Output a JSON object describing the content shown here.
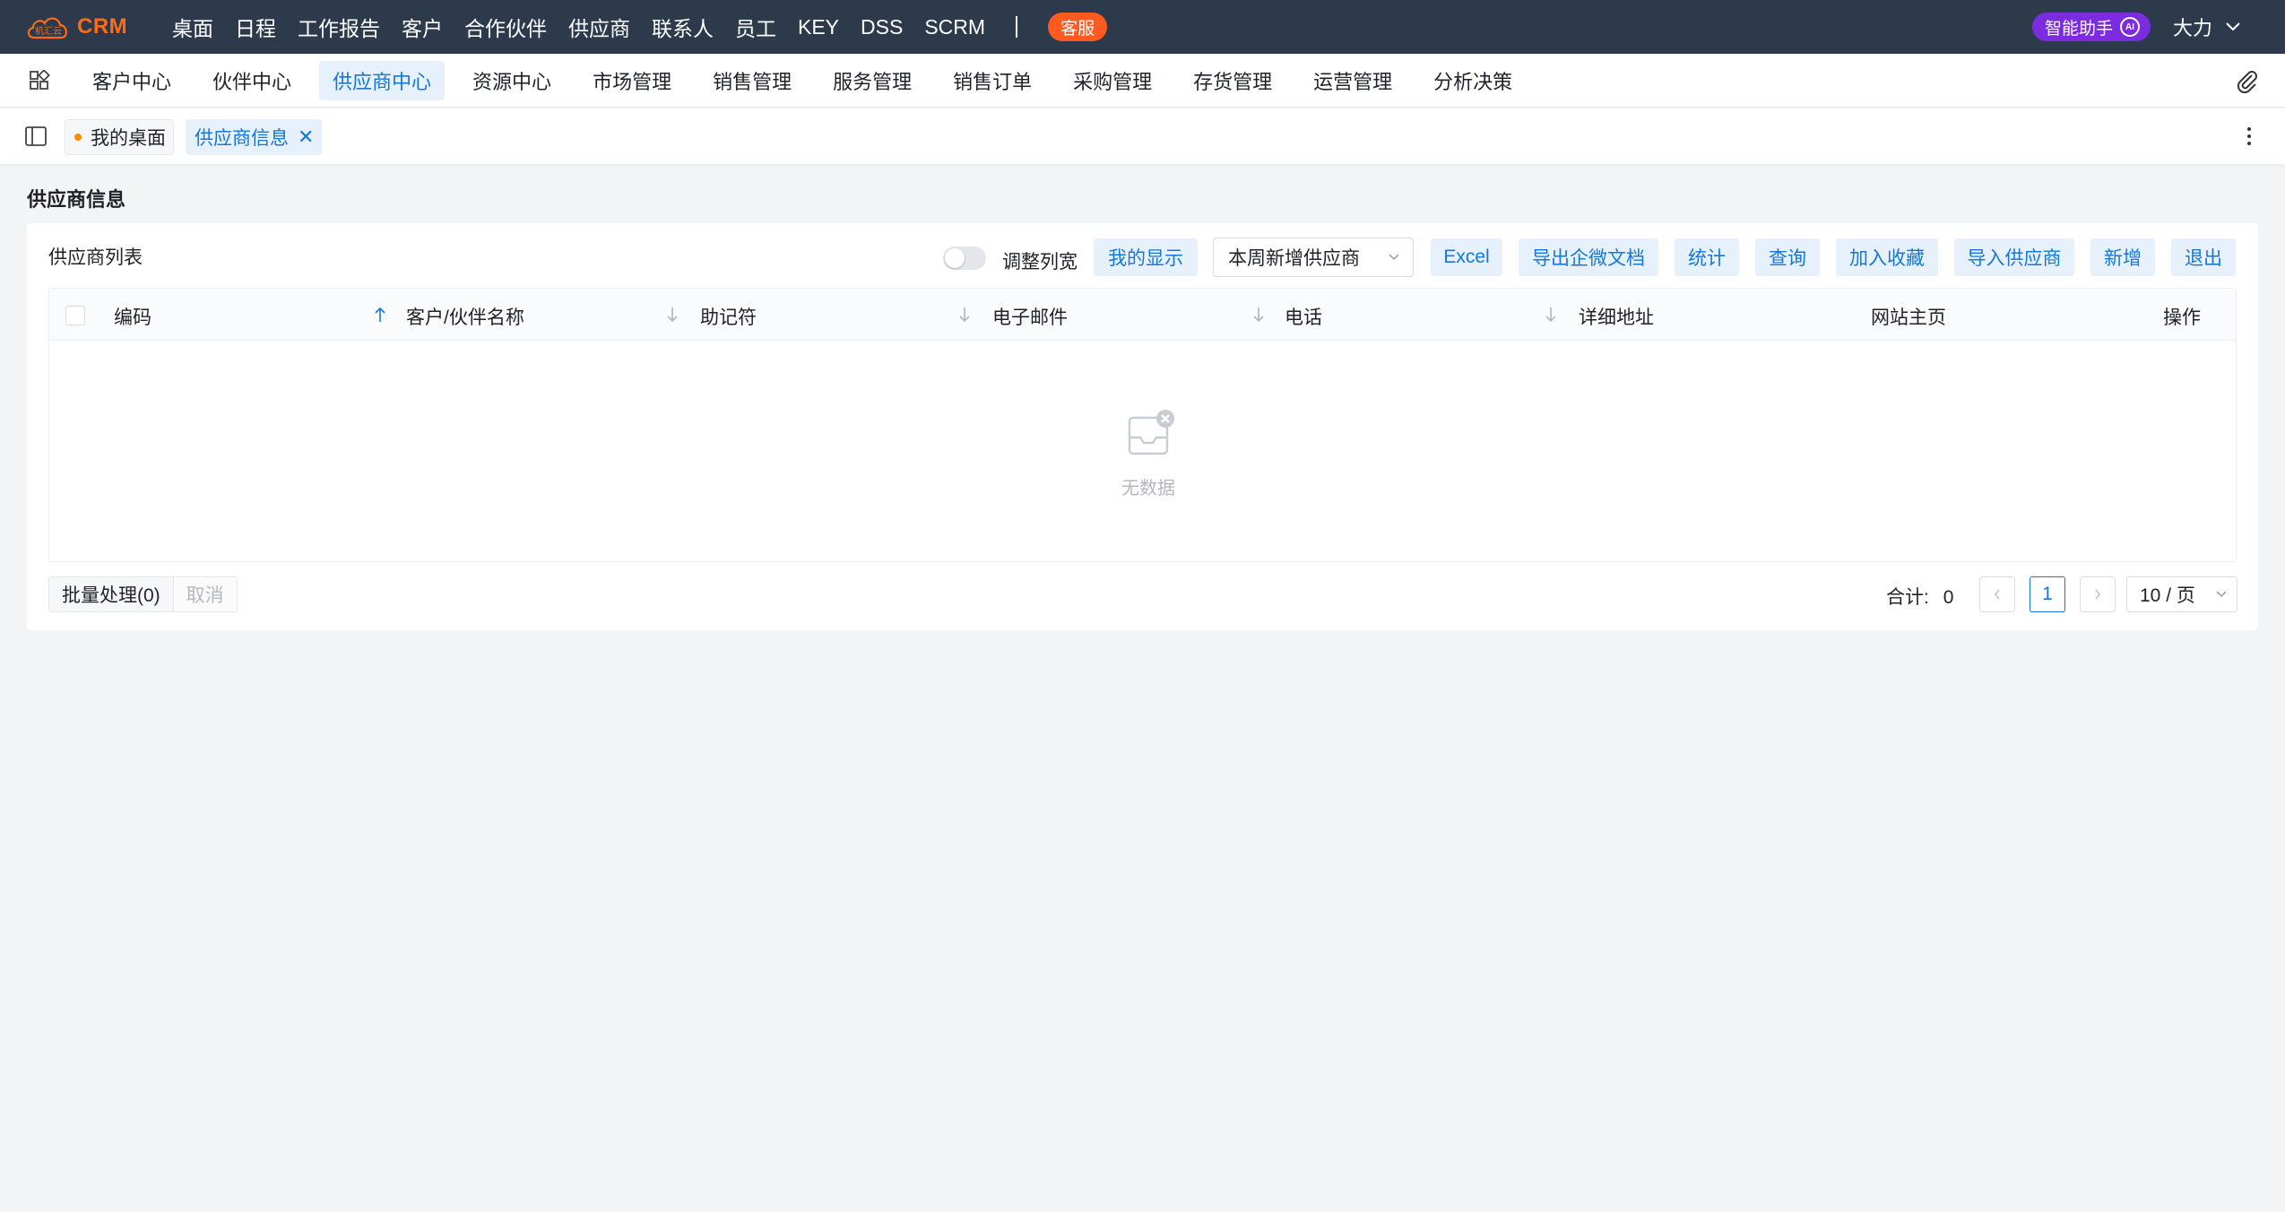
{
  "topbar": {
    "logo_text": "CRM",
    "logo_badge": "机汇云",
    "nav": [
      "桌面",
      "日程",
      "工作报告",
      "客户",
      "合作伙伴",
      "供应商",
      "联系人",
      "员工",
      "KEY",
      "DSS",
      "SCRM"
    ],
    "service_label": "客服",
    "ai_label": "智能助手",
    "ai_badge": "AI",
    "user_name": "大力"
  },
  "modules": {
    "items": [
      "客户中心",
      "伙伴中心",
      "供应商中心",
      "资源中心",
      "市场管理",
      "销售管理",
      "服务管理",
      "销售订单",
      "采购管理",
      "存货管理",
      "运营管理",
      "分析决策"
    ],
    "active": "供应商中心"
  },
  "tabs": {
    "home": "我的桌面",
    "current": "供应商信息",
    "close": "✕"
  },
  "page": {
    "title": "供应商信息"
  },
  "list": {
    "title": "供应商列表",
    "switch_label": "调整列宽",
    "my_display": "我的显示",
    "filter_value": "本周新增供应商",
    "buttons": [
      "Excel",
      "导出企微文档",
      "统计",
      "查询",
      "加入收藏",
      "导入供应商",
      "新增",
      "退出"
    ],
    "columns": [
      "编码",
      "客户/伙伴名称",
      "助记符",
      "电子邮件",
      "电话",
      "详细地址",
      "网站主页",
      "操作"
    ],
    "empty_text": "无数据"
  },
  "footer": {
    "batch_label": "批量处理(0)",
    "cancel_label": "取消",
    "total_label": "合计:",
    "total_value": "0",
    "current_page": "1",
    "page_size": "10 / 页"
  },
  "colors": {
    "topbar_bg": "#2c3a4b",
    "accent": "#1677d6",
    "accent_bg": "#e6f1fc",
    "service_orange": "#ff5a1f",
    "ai_purple": "#7b2cdf"
  }
}
